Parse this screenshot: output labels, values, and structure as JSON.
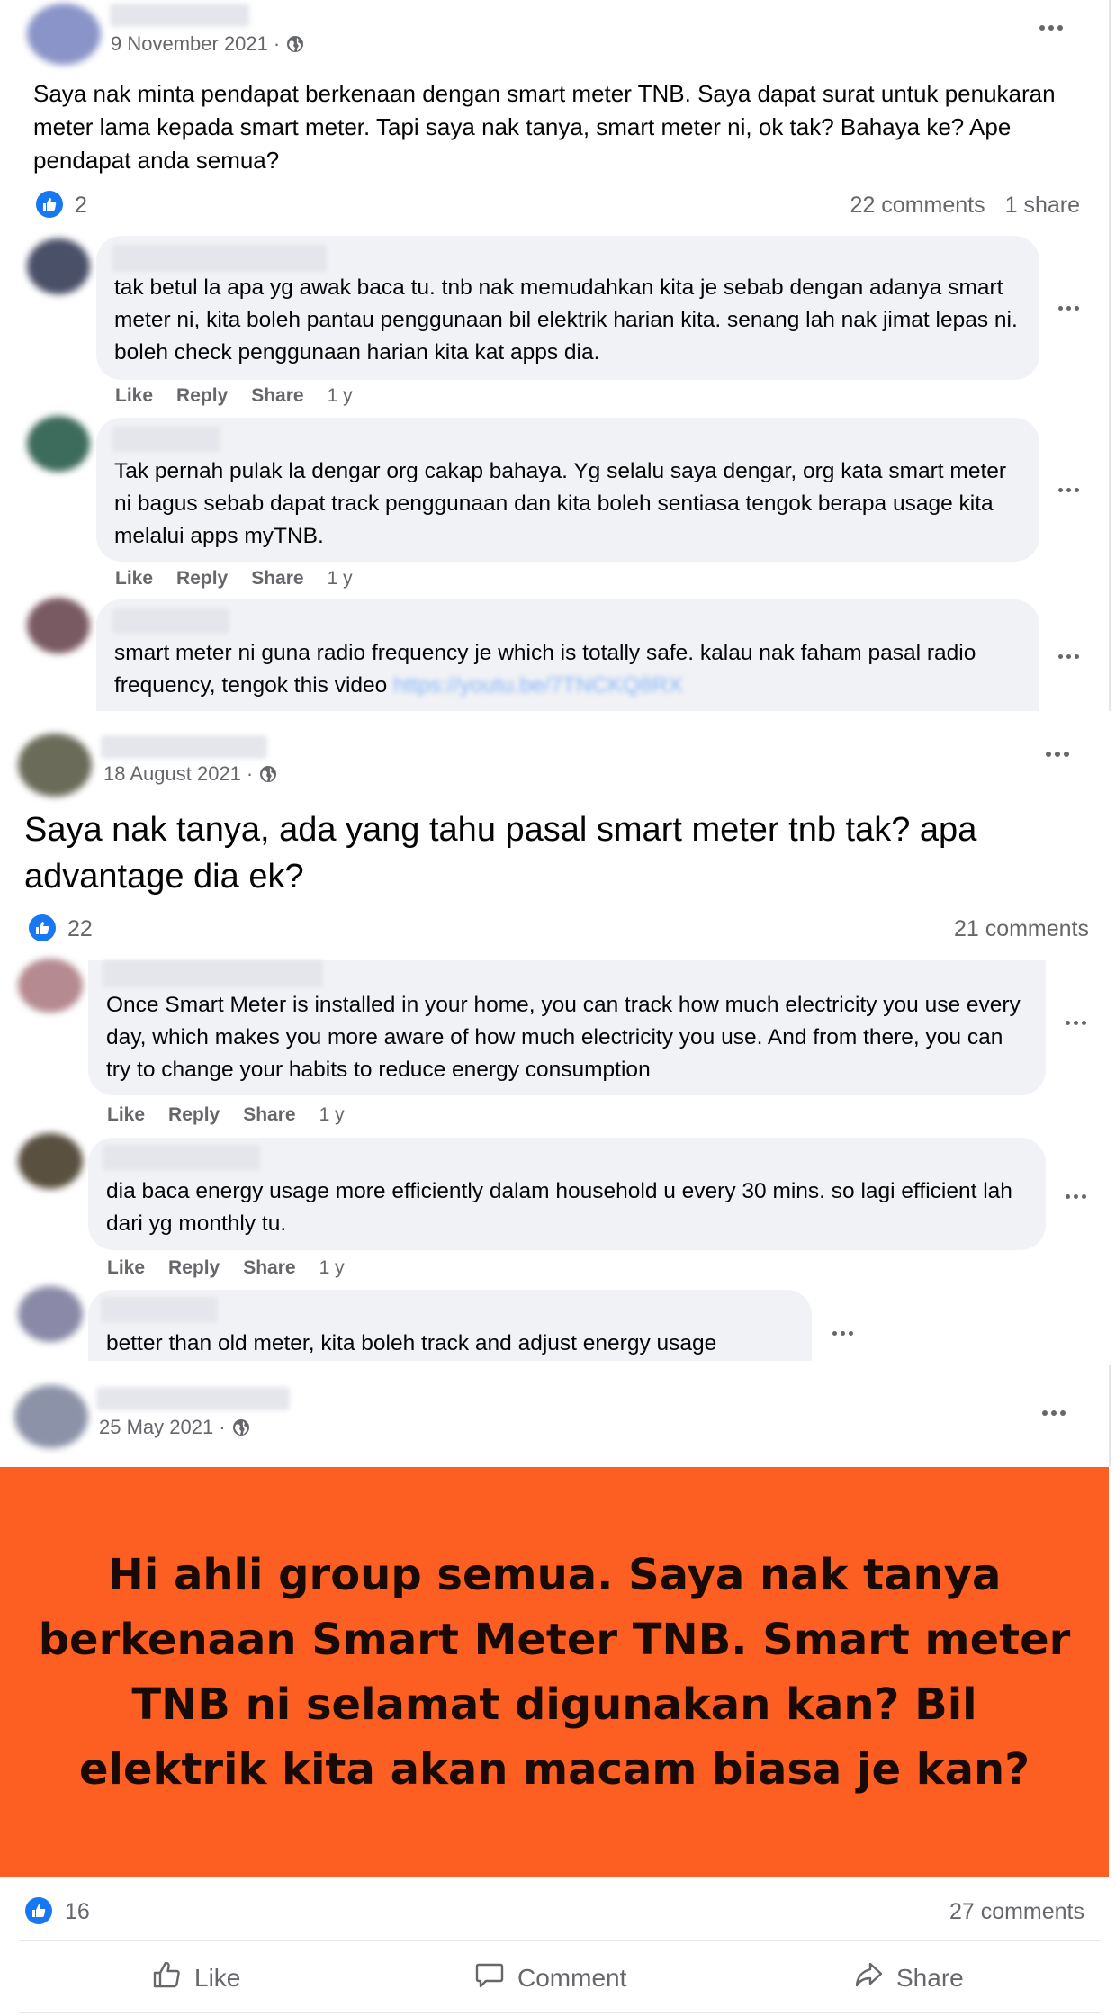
{
  "posts": [
    {
      "date": "9 November 2021",
      "text": "Saya nak minta pendapat berkenaan dengan smart meter TNB. Saya dapat surat untuk penukaran meter lama kepada smart meter. Tapi saya nak tanya, smart meter ni, ok tak? Bahaya ke? Ape pendapat anda semua?",
      "reactions": "2",
      "comments": "22 comments",
      "shares": "1 share",
      "comment_list": [
        {
          "text": "tak betul la apa yg awak baca tu. tnb nak memudahkan kita je sebab dengan adanya smart meter ni, kita boleh pantau penggunaan bil elektrik harian kita. senang lah nak jimat lepas ni. boleh check penggunaan harian kita kat apps dia.",
          "like": "Like",
          "reply": "Reply",
          "share": "Share",
          "age": "1 y"
        },
        {
          "text": "Tak pernah pulak la dengar org cakap bahaya. Yg selalu saya dengar, org kata smart meter ni bagus sebab dapat track penggunaan dan kita boleh sentiasa tengok berapa usage kita melalui apps myTNB.",
          "like": "Like",
          "reply": "Reply",
          "share": "Share",
          "age": "1 y"
        },
        {
          "text": "smart meter ni guna radio frequency je which is totally safe. kalau nak faham pasal radio frequency, tengok this video",
          "link": "https://youtu.be/7TNCKQ8RX"
        }
      ]
    },
    {
      "date": "18 August 2021",
      "text": "Saya nak tanya, ada yang tahu pasal smart meter tnb tak? apa advantage dia ek?",
      "reactions": "22",
      "comments": "21 comments",
      "comment_list": [
        {
          "text": "Once Smart Meter is installed in your home, you can track how much electricity you use every day, which makes you more aware of how much electricity you use. And from there, you can try to change your habits to reduce energy consumption",
          "like": "Like",
          "reply": "Reply",
          "share": "Share",
          "age": "1 y"
        },
        {
          "text": "dia baca energy usage more efficiently dalam household u every 30 mins. so lagi efficient lah dari yg monthly tu.",
          "like": "Like",
          "reply": "Reply",
          "share": "Share",
          "age": "1 y"
        },
        {
          "text": "better than old meter, kita boleh track and adjust energy usage"
        }
      ]
    },
    {
      "date": "25 May 2021",
      "banner_text": "Hi ahli group semua. Saya nak tanya berkenaan Smart Meter TNB. Smart meter TNB ni selamat digunakan kan? Bil elektrik kita akan macam biasa je kan?",
      "banner_color": "#fd5f22",
      "reactions": "16",
      "comments": "27 comments",
      "footer": {
        "like": "Like",
        "comment": "Comment",
        "share": "Share"
      }
    }
  ],
  "colors": {
    "accent": "#1877f2",
    "muted": "#65676b",
    "bubble": "#f0f2f5"
  },
  "icons": [
    "globe-icon",
    "more-options-icon",
    "like-reaction-icon",
    "thumbs-up-icon",
    "comment-icon",
    "share-arrow-icon"
  ]
}
